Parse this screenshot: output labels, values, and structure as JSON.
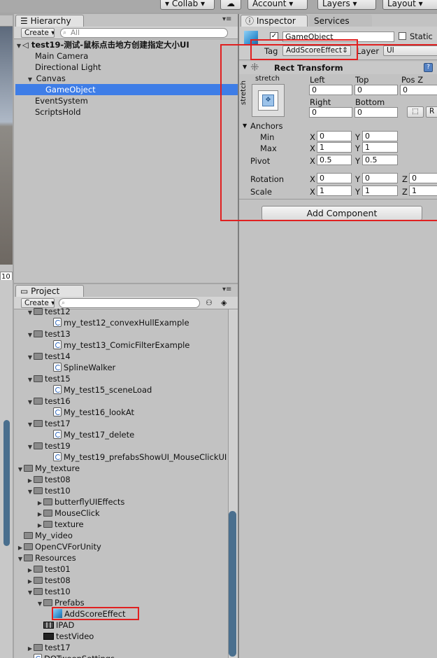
{
  "toolbar": {
    "collab": "Collab",
    "account": "Account",
    "layers": "Layers",
    "layout": "Layout"
  },
  "scene": {
    "number": "10"
  },
  "hierarchy": {
    "tab": "Hierarchy",
    "create": "Create",
    "search_placeholder": "All",
    "scene_title": "test19-测试-鼠标点击地方创建指定大小UI",
    "items": [
      "Main Camera",
      "Directional Light",
      "Canvas",
      "GameObject",
      "EventSystem",
      "ScriptsHold"
    ]
  },
  "inspector": {
    "tab": "Inspector",
    "services_tab": "Services",
    "name": "GameObject",
    "static_label": "Static",
    "tag_label": "Tag",
    "tag_value": "AddScoreEffect",
    "layer_label": "Layer",
    "layer_value": "UI",
    "component_title": "Rect Transform",
    "anchor_preset": "stretch",
    "anchor_side": "stretch",
    "headers": {
      "left": "Left",
      "top": "Top",
      "posz": "Pos Z",
      "right": "Right",
      "bottom": "Bottom"
    },
    "values": {
      "left": "0",
      "top": "0",
      "posz": "0",
      "right": "0",
      "bottom": "0"
    },
    "anchors_label": "Anchors",
    "min_label": "Min",
    "max_label": "Max",
    "min": {
      "x": "0",
      "y": "0"
    },
    "max": {
      "x": "1",
      "y": "1"
    },
    "pivot_label": "Pivot",
    "pivot": {
      "x": "0.5",
      "y": "0.5"
    },
    "rotation_label": "Rotation",
    "rotation": {
      "x": "0",
      "y": "0",
      "z": "0"
    },
    "scale_label": "Scale",
    "scale": {
      "x": "1",
      "y": "1",
      "z": "1"
    },
    "axis": {
      "x": "X",
      "y": "Y",
      "z": "Z"
    },
    "raw_button": "R",
    "add_component": "Add Component"
  },
  "project": {
    "tab": "Project",
    "create": "Create",
    "items": [
      "test12",
      "my_test12_convexHullExample",
      "test13",
      "my_test13_ComicFilterExample",
      "test14",
      "SplineWalker",
      "test15",
      "My_test15_sceneLoad",
      "test16",
      "My_test16_lookAt",
      "test17",
      "My_test17_delete",
      "test19",
      "My_test19_prefabsShowUI_MouseClickUI",
      "My_texture",
      "test08",
      "test10",
      "butterflyUIEffects",
      "MouseClick",
      "texture",
      "My_video",
      "OpenCVForUnity",
      "Resources",
      "test01",
      "test08",
      "test10",
      "Prefabs",
      "AddScoreEffect",
      "IPAD",
      "testVideo",
      "test17",
      "DOTweenSettings"
    ]
  },
  "colors": {
    "selection": "#3e7de7",
    "highlight": "#e02020"
  }
}
